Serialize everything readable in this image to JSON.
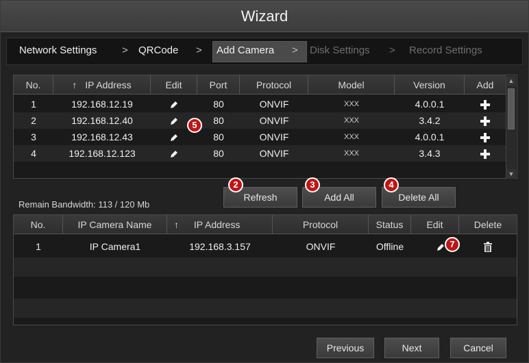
{
  "window": {
    "title": "Wizard"
  },
  "steps": [
    {
      "label": "Network Settings",
      "state": "done"
    },
    {
      "label": "QRCode",
      "state": "done"
    },
    {
      "label": "Add Camera",
      "state": "active"
    },
    {
      "label": "Disk Settings",
      "state": "disabled"
    },
    {
      "label": "Record Settings",
      "state": "disabled"
    }
  ],
  "step_separator": ">",
  "search_table": {
    "headers": [
      "No.",
      "IP Address",
      "Edit",
      "Port",
      "Protocol",
      "Model",
      "Version",
      "Add"
    ],
    "sort_indicator": "↑",
    "rows": [
      {
        "no": "1",
        "ip": "192.168.12.19",
        "port": "80",
        "protocol": "ONVIF",
        "model": "XXX",
        "version": "4.0.0.1"
      },
      {
        "no": "2",
        "ip": "192.168.12.40",
        "port": "80",
        "protocol": "ONVIF",
        "model": "XXX",
        "version": "3.4.2"
      },
      {
        "no": "3",
        "ip": "192.168.12.43",
        "port": "80",
        "protocol": "ONVIF",
        "model": "XXX",
        "version": "4.0.0.1"
      },
      {
        "no": "4",
        "ip": "192.168.12.123",
        "port": "80",
        "protocol": "ONVIF",
        "model": "XXX",
        "version": "3.4.3"
      }
    ]
  },
  "actions": {
    "refresh": "Refresh",
    "add_all": "Add All",
    "delete_all": "Delete All"
  },
  "bandwidth": {
    "text": "Remain Bandwidth: 113 / 120 Mb"
  },
  "added_table": {
    "headers": [
      "No.",
      "IP Camera Name",
      "IP Address",
      "Protocol",
      "Status",
      "Edit",
      "Delete"
    ],
    "sort_indicator": "↑",
    "rows": [
      {
        "no": "1",
        "name": "IP Camera1",
        "ip": "192.168.3.157",
        "protocol": "ONVIF",
        "status": "Offline"
      }
    ]
  },
  "footer": {
    "previous": "Previous",
    "next": "Next",
    "cancel": "Cancel"
  },
  "callouts": {
    "edit_row2": "5",
    "refresh": "2",
    "add_all": "3",
    "delete_all": "4",
    "edit_added": "7"
  },
  "colors": {
    "badge": "#c01515",
    "active_step_bg": "#4a4a4a",
    "disabled_text": "#6e6e6e"
  },
  "icons": {
    "edit": "pencil-icon",
    "add": "plus-icon",
    "delete": "trash-icon",
    "sort": "sort-up-arrow-icon"
  }
}
